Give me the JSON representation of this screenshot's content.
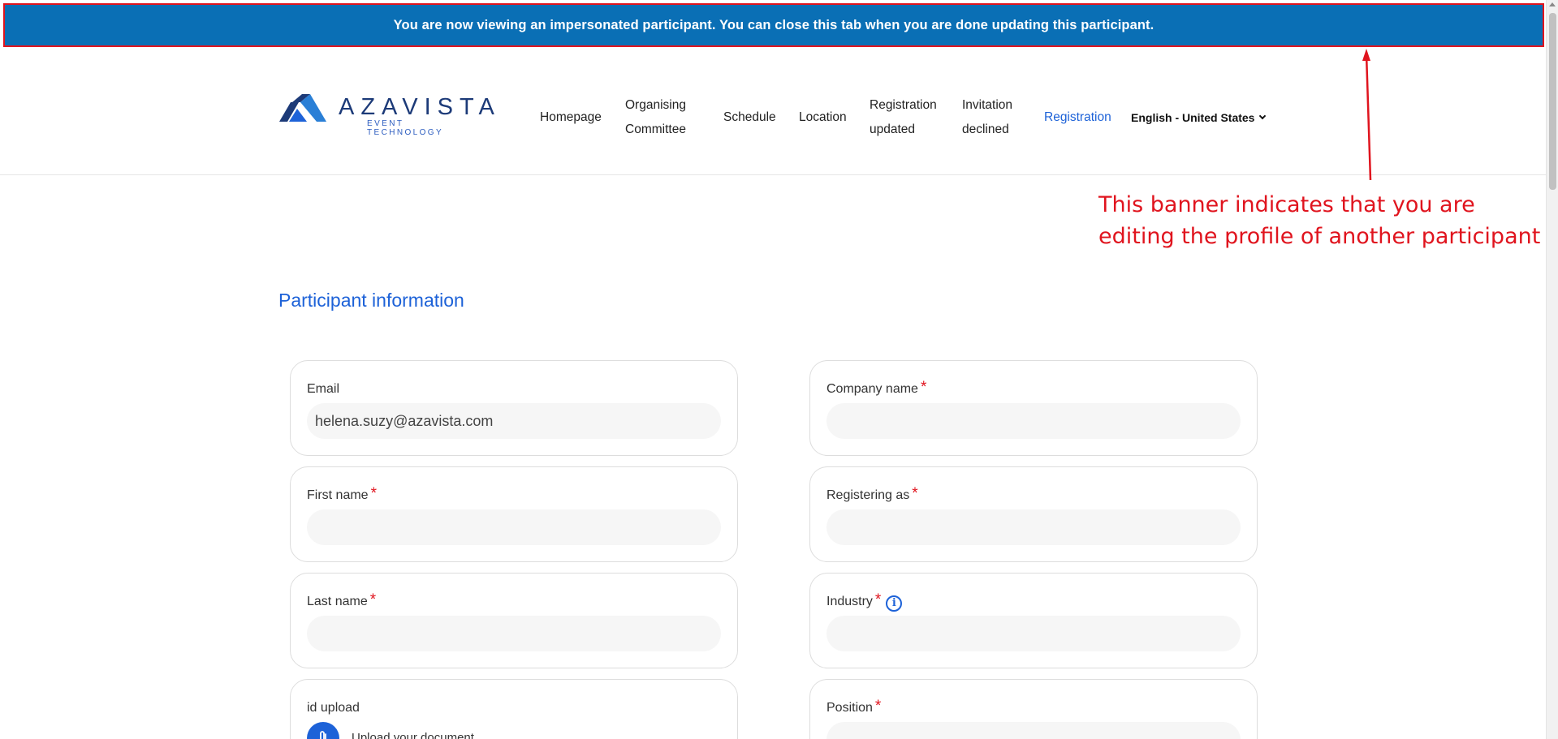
{
  "banner": {
    "text": "You are now viewing an impersonated participant. You can close this tab when you are done updating this participant."
  },
  "logo": {
    "name": "AZAVISTA",
    "subtitle": "EVENT TECHNOLOGY"
  },
  "nav": {
    "items": [
      {
        "label": "Homepage"
      },
      {
        "label": "Organising Committee"
      },
      {
        "label": "Schedule"
      },
      {
        "label": "Location"
      },
      {
        "label": "Registration updated"
      },
      {
        "label": "Invitation declined"
      },
      {
        "label": "Registration",
        "active": true
      }
    ],
    "language": "English - United States"
  },
  "annotation": {
    "line1": "This banner indicates that you are",
    "line2": "editing the profile of another participant",
    "color": "#e0141e"
  },
  "section": {
    "title": "Participant information"
  },
  "form": {
    "email": {
      "label": "Email",
      "value": "helena.suzy@azavista.com"
    },
    "company_name": {
      "label": "Company name",
      "required": "*",
      "value": ""
    },
    "first_name": {
      "label": "First name",
      "required": "*",
      "value": ""
    },
    "registering_as": {
      "label": "Registering as",
      "required": "*",
      "value": ""
    },
    "last_name": {
      "label": "Last name",
      "required": "*",
      "value": ""
    },
    "industry": {
      "label": "Industry",
      "required": "*",
      "value": ""
    },
    "id_upload": {
      "label": "id upload",
      "upload_text": "Upload your document"
    },
    "position": {
      "label": "Position",
      "required": "*",
      "value": ""
    }
  },
  "colors": {
    "banner_bg": "#0a6fb5",
    "accent": "#1d62d8",
    "required": "#e0141e"
  }
}
